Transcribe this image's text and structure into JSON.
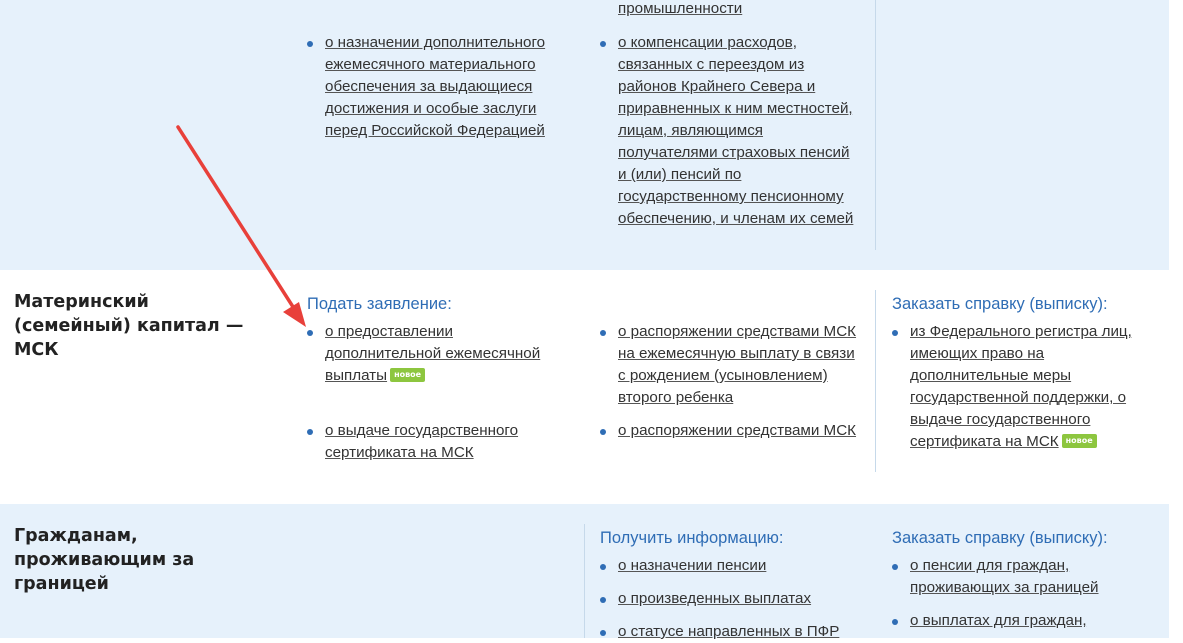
{
  "top_section": {
    "col1_links": [
      {
        "text": "о назначении дополнительного ежемесячного материального обеспечения за выдающиеся достижения и особые заслуги перед Российской Федерацией"
      }
    ],
    "col2_prev_fragment": "промышленности",
    "col2_links": [
      {
        "text": "о компенсации расходов, связанных с переездом из районов Крайнего Севера и приравненных к ним местностей, лицам, являющимся получателями страховых пенсий и (или) пенсий по государственному пенсионному обеспечению, и членам их семей"
      }
    ]
  },
  "msk_section": {
    "title": "Материнский (семейный) капитал — МСК",
    "apply_heading": "Подать заявление:",
    "col1_links": [
      {
        "text": " о предоставлении дополнительной ежемесячной выплаты",
        "badge": "новое"
      },
      {
        "text": "о выдаче государственного сертификата на МСК"
      }
    ],
    "col2_links": [
      {
        "text": "о распоряжении средствами МСК на ежемесячную выплату в связи с рождением (усыновлением) второго ребенка"
      },
      {
        "text": "о распоряжении средствами МСК"
      }
    ],
    "order_heading": "Заказать справку (выписку):",
    "col3_links": [
      {
        "text": "из Федерального регистра лиц, имеющих право на дополнительные меры государственной поддержки, о выдаче государственного сертификата на МСК",
        "badge": "новое"
      }
    ]
  },
  "abroad_section": {
    "title": "Гражданам, проживающим за границей",
    "info_heading": "Получить информацию:",
    "col2_links": [
      {
        "text": "о назначении пенсии"
      },
      {
        "text": "о произведенных выплатах"
      },
      {
        "text": "о статусе направленных в ПФР"
      }
    ],
    "order_heading": "Заказать справку (выписку):",
    "col3_links": [
      {
        "text": "о пенсии для граждан, проживающих за границей"
      },
      {
        "text": "о выплатах для граждан,"
      }
    ]
  },
  "colors": {
    "band_blue": "#e6f1fb",
    "heading_blue": "#2f6db5",
    "badge_green": "#8dc63f",
    "arrow_red": "#e8403a"
  },
  "annotation": {
    "icon": "red-arrow-icon"
  }
}
